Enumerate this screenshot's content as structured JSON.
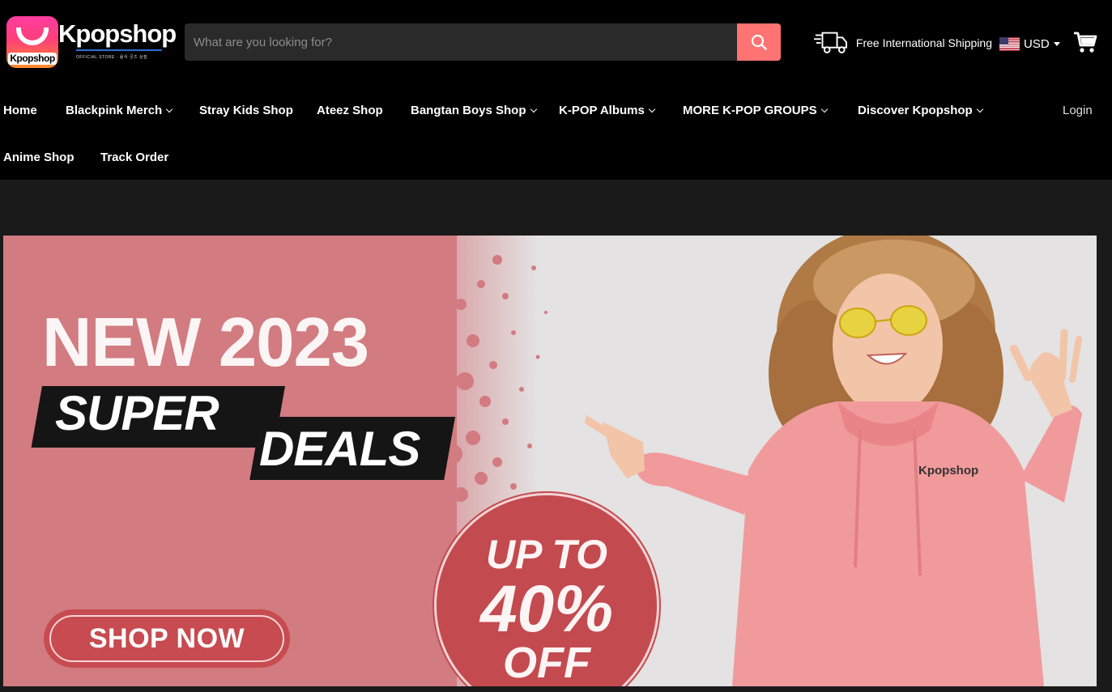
{
  "brand": {
    "name": "Kpopshop",
    "badge_text": "Kpopshop",
    "tagline": "OFFICIAL STORE · 음식 굿즈 상점"
  },
  "search": {
    "placeholder": "What are you looking for?",
    "value": "",
    "button_icon": "search-icon"
  },
  "shipping": {
    "icon": "delivery-truck-icon",
    "label": "Free International Shipping"
  },
  "currency": {
    "flag": "us-flag-icon",
    "selected": "USD"
  },
  "cart": {
    "icon": "shopping-cart-icon"
  },
  "nav": {
    "items": [
      {
        "label": "Home",
        "dropdown": false
      },
      {
        "label": "Blackpink Merch",
        "dropdown": true
      },
      {
        "label": "Stray Kids Shop",
        "dropdown": false
      },
      {
        "label": "Ateez Shop",
        "dropdown": false
      },
      {
        "label": "Bangtan Boys Shop",
        "dropdown": true
      },
      {
        "label": "K-POP Albums",
        "dropdown": true
      },
      {
        "label": "MORE K-POP GROUPS",
        "dropdown": true
      },
      {
        "label": "Discover Kpopshop",
        "dropdown": true
      },
      {
        "label": "Anime Shop",
        "dropdown": false
      },
      {
        "label": "Track Order",
        "dropdown": false
      }
    ],
    "login": "Login"
  },
  "banner": {
    "headline": "NEW 2023",
    "super": "SUPER",
    "deals": "DEALS",
    "offer_line1": "UP TO",
    "offer_line2": "40%",
    "offer_line3": "OFF",
    "cta": "SHOP NOW",
    "hoodie_text": "Kpopshop",
    "colors": {
      "pink": "#d27b80",
      "deep_red": "#c34a4f",
      "hoodie": "#f19a9c"
    }
  },
  "colors": {
    "header_bg": "#000000",
    "page_bg": "#1a1a1a",
    "search_button": "#ff7373"
  }
}
